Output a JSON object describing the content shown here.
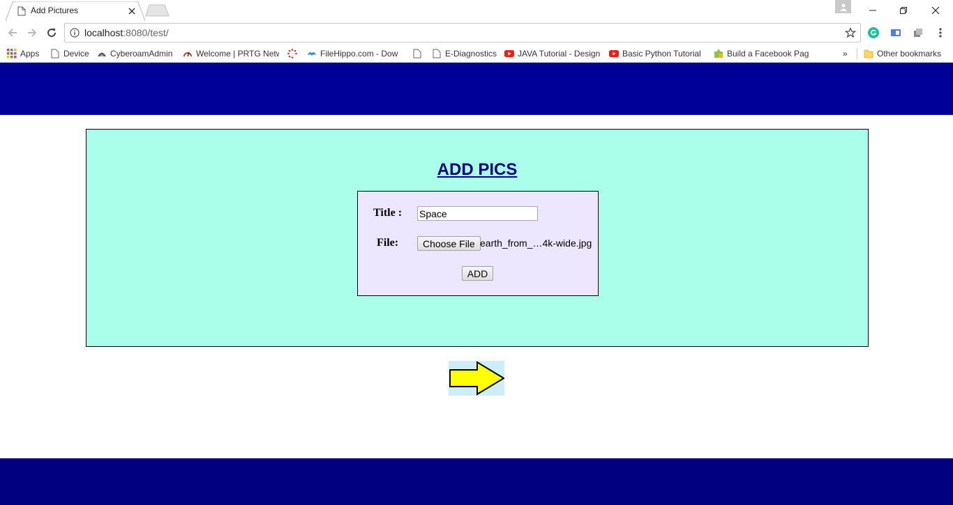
{
  "browser": {
    "tab_title": "Add Pictures",
    "url_host": "localhost",
    "url_path": ":8080/test/"
  },
  "bookmarks": [
    {
      "label": "Apps",
      "icon": "apps-grid-icon"
    },
    {
      "label": "Device",
      "icon": "page-icon"
    },
    {
      "label": "CyberoamAdmin",
      "icon": "cyberoam-icon"
    },
    {
      "label": "Welcome | PRTG Netw",
      "icon": "prtg-icon"
    },
    {
      "label": "",
      "icon": "spinner-icon"
    },
    {
      "label": "FileHippo.com - Dow",
      "icon": "filehippo-icon"
    },
    {
      "label": "",
      "icon": "page-icon"
    },
    {
      "label": "E-Diagnostics",
      "icon": "page-icon"
    },
    {
      "label": "JAVA Tutorial - Design",
      "icon": "youtube-icon"
    },
    {
      "label": "Basic Python Tutorial",
      "icon": "youtube-icon"
    },
    {
      "label": "Build a Facebook Pag",
      "icon": "puzzle-icon"
    }
  ],
  "bookmarks_overflow": "»",
  "other_bookmarks": "Other bookmarks",
  "page": {
    "heading": "ADD PICS",
    "title_label": "Title :",
    "title_value": "Space",
    "file_label": "File:",
    "choose_file_label": "Choose File",
    "file_name": "earth_from_…4k-wide.jpg",
    "add_label": "ADD",
    "next_icon": "yellow-right-arrow-icon"
  },
  "colors": {
    "header_band": "#000099",
    "footer_band": "#000080",
    "panel_bg": "#aaffea",
    "form_bg": "#ece6ff",
    "heading": "#000080",
    "arrow_fill": "#ffff00",
    "arrow_bg": "#cdeef8"
  }
}
